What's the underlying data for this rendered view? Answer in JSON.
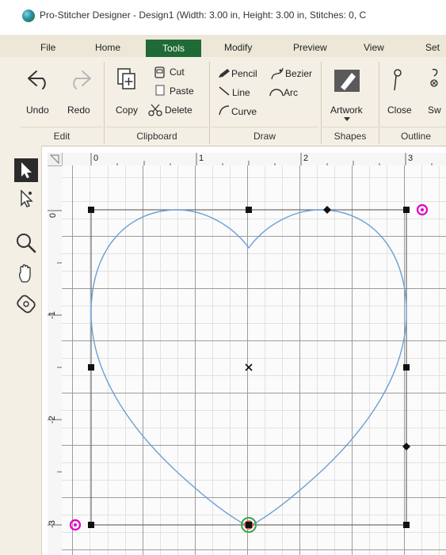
{
  "window": {
    "title": "Pro-Stitcher Designer - Design1 (Width: 3.00 in, Height: 3.00 in, Stitches: 0, C"
  },
  "tabs": [
    {
      "label": "File"
    },
    {
      "label": "Home"
    },
    {
      "label": "Tools",
      "active": true
    },
    {
      "label": "Modify"
    },
    {
      "label": "Preview"
    },
    {
      "label": "View"
    },
    {
      "label": "Set"
    }
  ],
  "ribbon": {
    "edit": {
      "undo": "Undo",
      "redo": "Redo",
      "group": "Edit"
    },
    "clipboard": {
      "copy": "Copy",
      "cut": "Cut",
      "paste": "Paste",
      "delete": "Delete",
      "group": "Clipboard"
    },
    "draw": {
      "pencil": "Pencil",
      "bezier": "Bezier",
      "line": "Line",
      "arc": "Arc",
      "curve": "Curve",
      "group": "Draw"
    },
    "shapes": {
      "artwork": "Artwork",
      "group": "Shapes"
    },
    "outline": {
      "close": "Close",
      "sw": "Sw",
      "group": "Outline"
    }
  },
  "tools": [
    "select-arrow",
    "node-edit-arrow",
    "zoom-magnifier",
    "pan-hand",
    "tape-measure"
  ],
  "ruler": {
    "top": [
      "0",
      "1",
      "2",
      "3"
    ],
    "left": [
      "0",
      "-1",
      "-2",
      "-3"
    ]
  },
  "design": {
    "shape": "heart",
    "width_in": 3.0,
    "height_in": 3.0,
    "stroke_color": "#6aa0d6"
  },
  "colors": {
    "accent": "#1f6a36",
    "ribbon_bg": "#f4efe5",
    "start_marker": "#e000c8",
    "stop_marker": "#3aa64a"
  }
}
